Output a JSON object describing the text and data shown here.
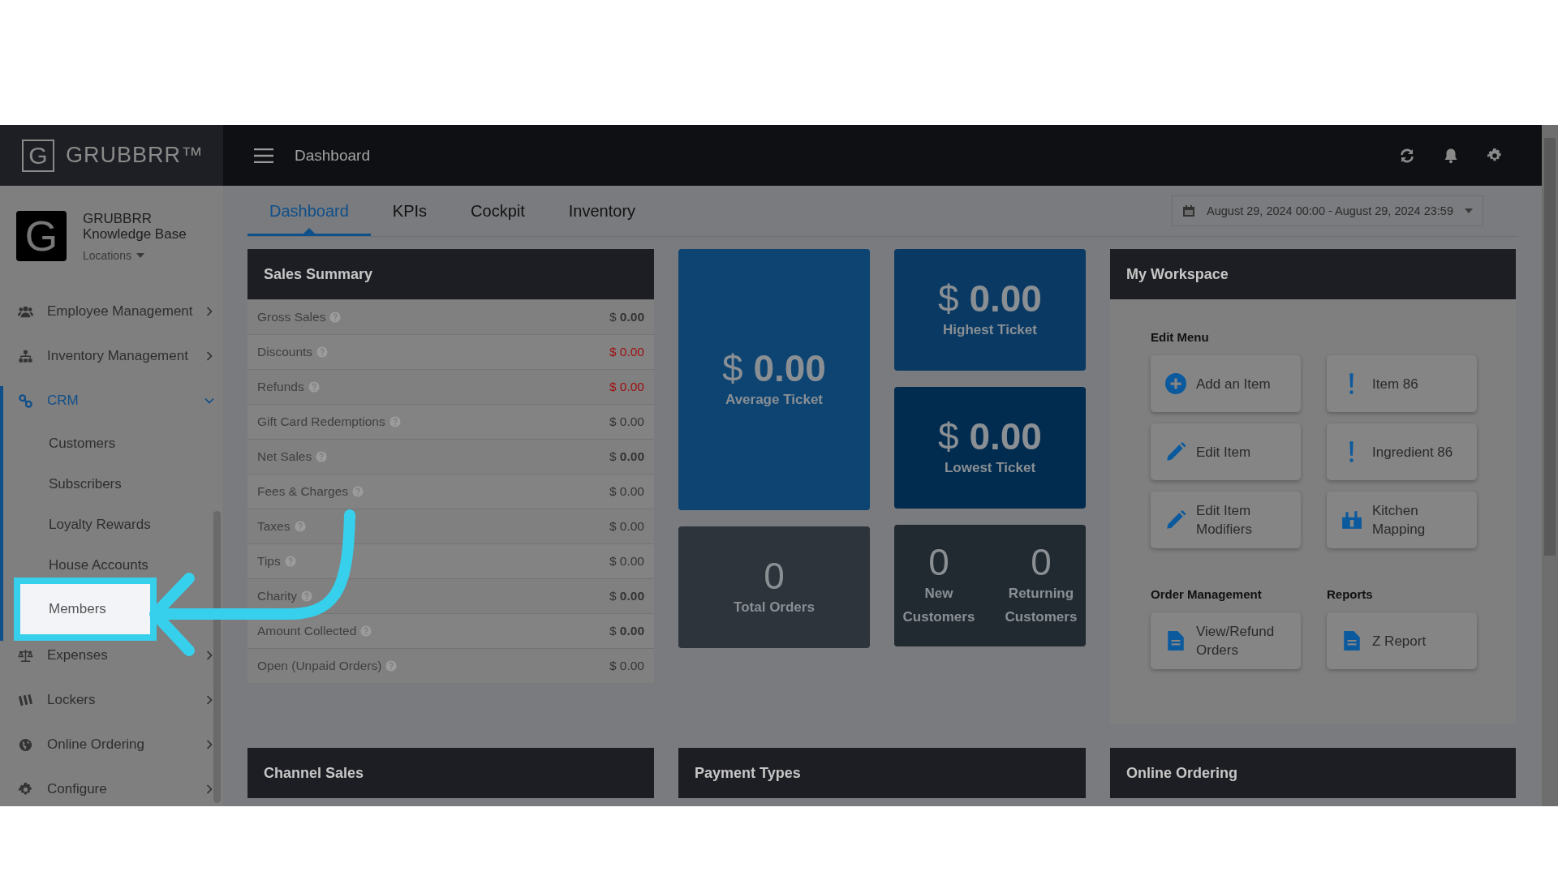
{
  "brand": {
    "logo_mark": "G",
    "name": "GRUBBRR™"
  },
  "top_bar": {
    "title": "Dashboard"
  },
  "account": {
    "avatar_letter": "G",
    "name": "GRUBBRR Knowledge Base",
    "locations": "Locations"
  },
  "sidebar": {
    "items": [
      {
        "label": "Employee Management",
        "selected": false,
        "expanded": false
      },
      {
        "label": "Inventory Management",
        "selected": false,
        "expanded": false
      },
      {
        "label": "CRM",
        "selected": true,
        "expanded": true,
        "children": [
          {
            "label": "Customers",
            "highlighted": false
          },
          {
            "label": "Subscribers",
            "highlighted": false
          },
          {
            "label": "Loyalty Rewards",
            "highlighted": false
          },
          {
            "label": "House Accounts",
            "highlighted": false
          },
          {
            "label": "Members",
            "highlighted": true
          }
        ]
      },
      {
        "label": "Expenses",
        "selected": false,
        "expanded": false
      },
      {
        "label": "Lockers",
        "selected": false,
        "expanded": false
      },
      {
        "label": "Online Ordering",
        "selected": false,
        "expanded": false
      },
      {
        "label": "Configure",
        "selected": false,
        "expanded": false
      }
    ]
  },
  "tabs": [
    {
      "label": "Dashboard",
      "selected": true
    },
    {
      "label": "KPIs",
      "selected": false
    },
    {
      "label": "Cockpit",
      "selected": false
    },
    {
      "label": "Inventory",
      "selected": false
    }
  ],
  "date_range": "August 29, 2024 00:00 - August 29, 2024 23:59",
  "sales_summary": {
    "title": "Sales Summary",
    "rows": [
      {
        "label": "Gross Sales",
        "value": "$ **0.00**",
        "kind": "plain"
      },
      {
        "label": "Discounts",
        "value": "$ 0.00",
        "kind": "negative"
      },
      {
        "label": "Refunds",
        "value": "$ 0.00",
        "kind": "negative"
      },
      {
        "label": "Gift Card Redemptions",
        "value": "$ 0.00",
        "kind": "plain"
      },
      {
        "label": "Net Sales",
        "value": "$ **0.00**",
        "kind": "plain"
      },
      {
        "label": "Fees & Charges",
        "value": "$ 0.00",
        "kind": "plain"
      },
      {
        "label": "Taxes",
        "value": "$ 0.00",
        "kind": "plain"
      },
      {
        "label": "Tips",
        "value": "$ 0.00",
        "kind": "plain"
      },
      {
        "label": "Charity",
        "value": "$ **0.00**",
        "kind": "plain"
      },
      {
        "label": "Amount Collected",
        "value": "$ **0.00**",
        "kind": "plain"
      },
      {
        "label": "Open (Unpaid Orders)",
        "value": "$ 0.00",
        "kind": "plain"
      }
    ]
  },
  "tile_columns": [
    {
      "tiles": [
        {
          "kind": "tall",
          "color": "#0d4472",
          "stats": [
            {
              "value": "$ **0.00**",
              "label": "Average Ticket"
            }
          ]
        },
        {
          "kind": "normal",
          "color": "#2e343b",
          "stats": [
            {
              "value": "0",
              "label": "Total Orders"
            }
          ]
        }
      ]
    },
    {
      "tiles": [
        {
          "kind": "normal",
          "color": "#0a3a64",
          "stats": [
            {
              "value": "$ **0.00**",
              "label": "Highest Ticket"
            }
          ]
        },
        {
          "kind": "normal",
          "color": "#022c4f",
          "stats": [
            {
              "value": "$ **0.00**",
              "label": "Lowest Ticket"
            }
          ]
        },
        {
          "kind": "normal",
          "color": "#222a31",
          "stats": [
            {
              "value": "0",
              "label": "New Customers"
            },
            {
              "value": "0",
              "label": "Returning Customers"
            }
          ]
        }
      ]
    }
  ],
  "workspace": {
    "title": "My Workspace",
    "groups": [
      {
        "title": "Edit Menu",
        "buttons": [
          {
            "label": "Add an Item",
            "kind": "add"
          },
          {
            "label": "Item 86",
            "kind": "alert"
          },
          {
            "label": "Edit Item",
            "kind": "edit"
          },
          {
            "label": "Ingredient 86",
            "kind": "alert"
          },
          {
            "label": "Edit Item Modifiers",
            "kind": "edit"
          },
          {
            "label": "Kitchen Mapping",
            "kind": "kitchen"
          }
        ]
      },
      {
        "title": "Order Management",
        "buttons": [
          {
            "label": "View/Refund Orders",
            "kind": "document"
          }
        ]
      },
      {
        "title": "Reports",
        "buttons": [
          {
            "label": "Z Report",
            "kind": "document"
          }
        ]
      }
    ]
  },
  "bottom_cards": [
    "Channel Sales",
    "Payment Types",
    "Online Ordering"
  ]
}
